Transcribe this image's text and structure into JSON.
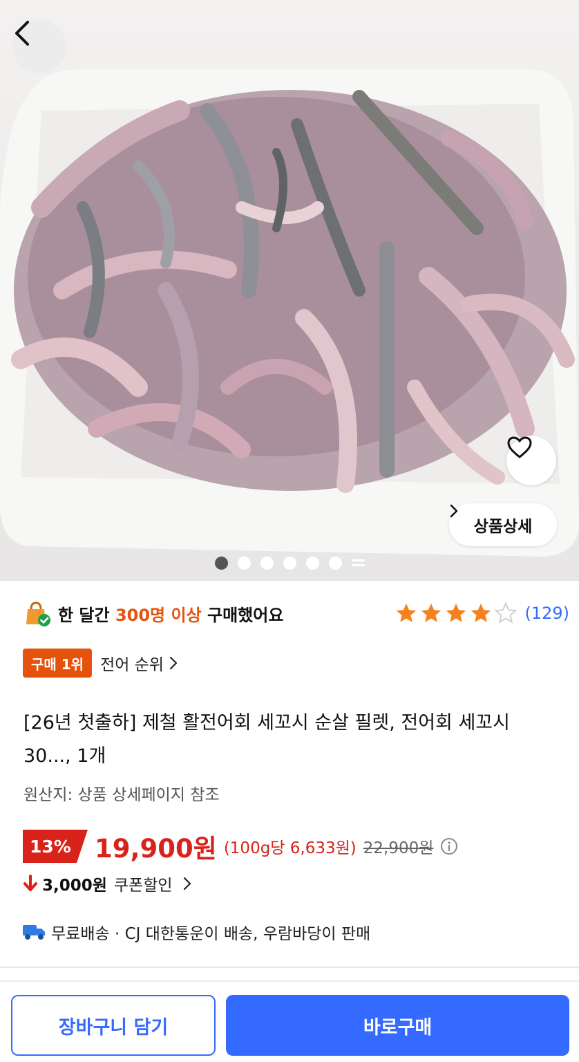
{
  "product_image": {
    "alt": "product-photo",
    "pager": {
      "total": 6,
      "active": 0
    }
  },
  "hero": {
    "detail_label": "상품상세"
  },
  "social_proof": {
    "prefix": "한 달간 ",
    "highlight": "300명 이상",
    "suffix": " 구매했어요"
  },
  "rating": {
    "stars": 4,
    "max": 5,
    "count": "(129)",
    "star_color": "#f5821f",
    "empty_color": "#cfcfcf"
  },
  "ranking": {
    "badge": "구매 1위",
    "category": "전어 순위"
  },
  "product": {
    "title": "[26년 첫출하] 제철 활전어회 세꼬시 순살 필렛, 전어회 세꼬시 30..., 1개",
    "origin": "원산지: 상품 상세페이지 참조"
  },
  "price": {
    "discount": "13%",
    "sale": "19,900원",
    "unit": "(100g당 6,633원)",
    "original": "22,900원"
  },
  "coupon": {
    "amount": "3,000원",
    "label": "쿠폰할인"
  },
  "shipping": {
    "text": "무료배송 · CJ 대한통운이 배송, 우람바당이 판매"
  },
  "actions": {
    "cart": "장바구니 담기",
    "buy": "바로구매"
  },
  "colors": {
    "accent": "#346aff",
    "brand_orange": "#e5520c",
    "price_red": "#d8221a"
  }
}
